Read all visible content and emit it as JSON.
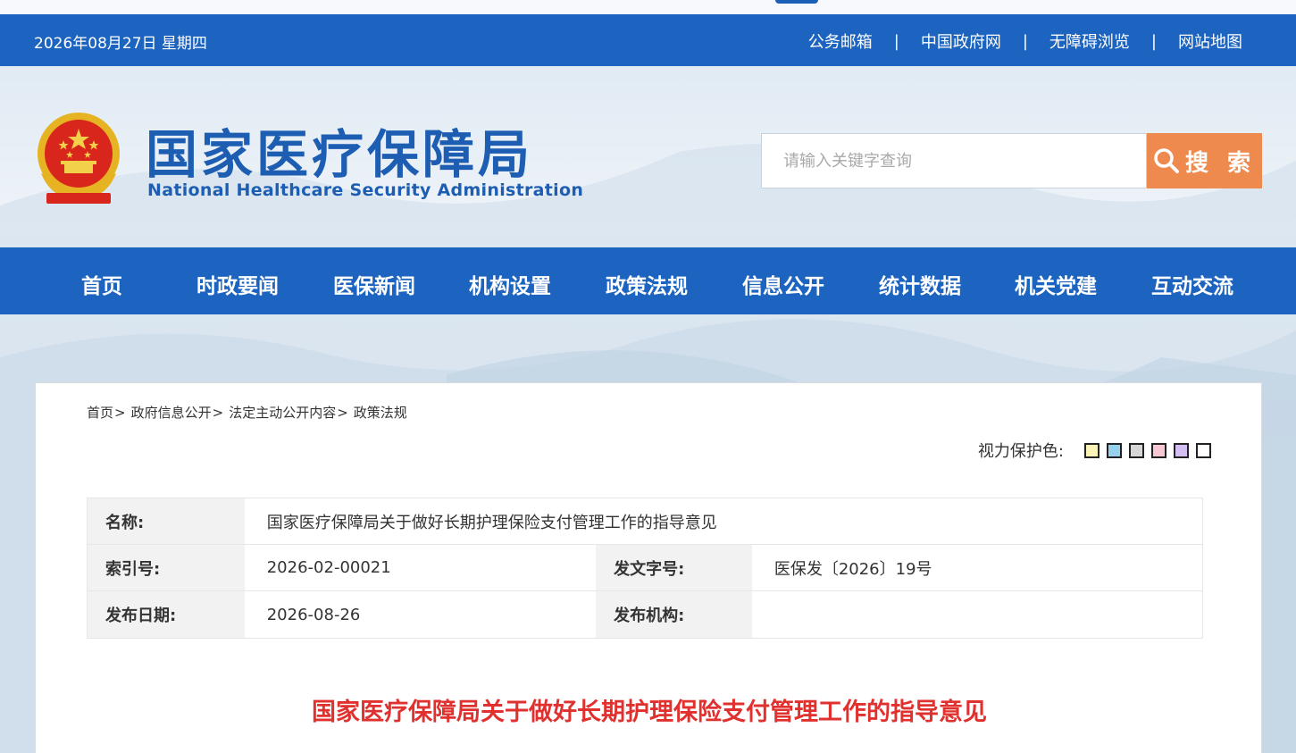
{
  "top_bar": {
    "date": "2026年08月27日 星期四",
    "links": [
      "公务邮箱",
      "中国政府网",
      "无障碍浏览",
      "网站地图"
    ],
    "separator": "|"
  },
  "header": {
    "title": "国家医疗保障局",
    "subtitle": "National Healthcare Security Administration",
    "search": {
      "placeholder": "请输入关键字查询",
      "button_label": "搜 索"
    }
  },
  "nav": {
    "items": [
      "首页",
      "时政要闻",
      "医保新闻",
      "机构设置",
      "政策法规",
      "信息公开",
      "统计数据",
      "机关党建",
      "互动交流"
    ]
  },
  "breadcrumb": {
    "items": [
      "首页",
      "政府信息公开",
      "法定主动公开内容",
      "政策法规"
    ],
    "separator": ">"
  },
  "eye_protection": {
    "label": "视力保护色:",
    "colors": [
      "#fbf3b8",
      "#96d0ee",
      "#d6d6d6",
      "#f8c7d4",
      "#d4bff3",
      "#ffffff"
    ]
  },
  "meta": {
    "name_label": "名称:",
    "name_value": "国家医疗保障局关于做好长期护理保险支付管理工作的指导意见",
    "index_label": "索引号:",
    "index_value": "2026-02-00021",
    "doc_no_label": "发文字号:",
    "doc_no_value": "医保发〔2026〕19号",
    "date_label": "发布日期:",
    "date_value": "2026-08-26",
    "org_label": "发布机构:",
    "org_value": ""
  },
  "article": {
    "title": "国家医疗保障局关于做好长期护理保险支付管理工作的指导意见"
  },
  "colors": {
    "primary_blue": "#1c64bf",
    "search_orange": "#ef8a4f",
    "title_red": "#e0312f"
  }
}
